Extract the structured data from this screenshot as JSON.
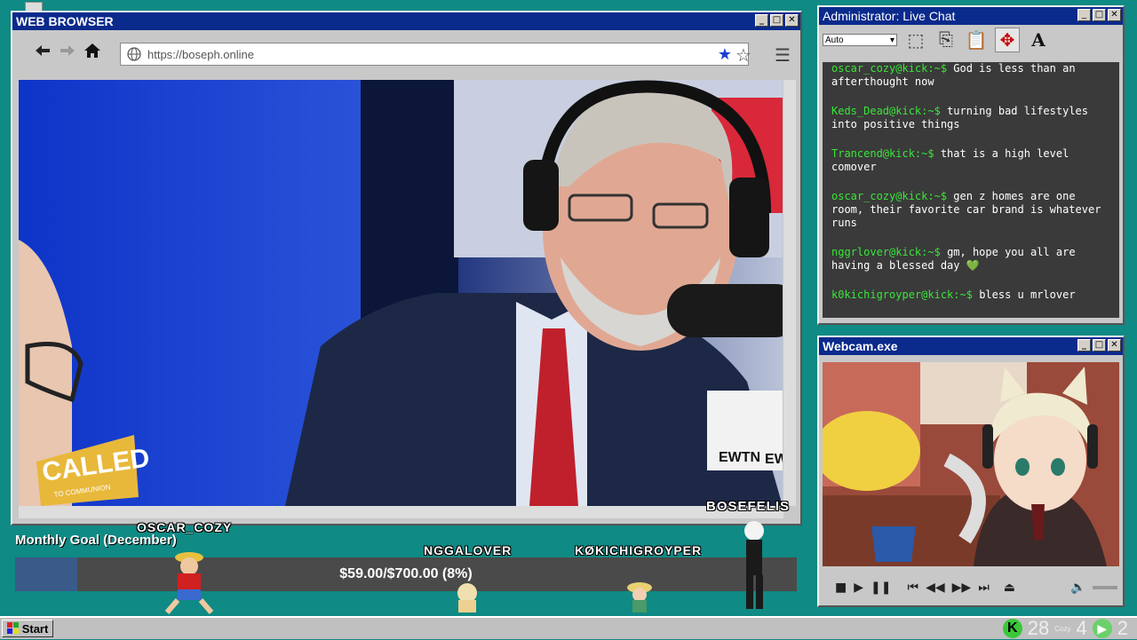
{
  "browser": {
    "title": "WEB BROWSER",
    "url": "https://boseph.online",
    "watermark": "BOSEFELIS",
    "video_sign": "CALLED",
    "video_sign_sub": "TO COMMUNION",
    "mic_brand": "EWTN",
    "mic_brand_right": "EW"
  },
  "chat": {
    "title": "Administrator: Live Chat",
    "font_size_select": "Auto",
    "messages": [
      {
        "user": "oscar_cozy@kick:~$",
        "text": "God is less than an afterthought now"
      },
      {
        "user": "Keds_Dead@kick:~$",
        "text": "turning bad lifestyles into positive things"
      },
      {
        "user": "Trancend@kick:~$",
        "text": "that is a high level comover"
      },
      {
        "user": "oscar_cozy@kick:~$",
        "text": "gen z homes are one room, their favorite car brand is whatever runs"
      },
      {
        "user": "nggrlover@kick:~$",
        "text": "gm, hope you all are having a blessed day 💚"
      },
      {
        "user": "k0kichigroyper@kick:~$",
        "text": "bless u mrlover"
      }
    ]
  },
  "webcam": {
    "title": "Webcam.exe"
  },
  "goal": {
    "title": "Monthly Goal (December)",
    "text": "$59.00/$700.00 (8%)",
    "fraction": 0.08
  },
  "nicks": [
    "OSCAR_COZY",
    "NGGALOVER",
    "KØKICHIGROYPER"
  ],
  "taskbar": {
    "start": "Start",
    "tray_a": "28",
    "tray_b": "4",
    "tray_c": "2",
    "tray_cozy": "Cozy"
  }
}
